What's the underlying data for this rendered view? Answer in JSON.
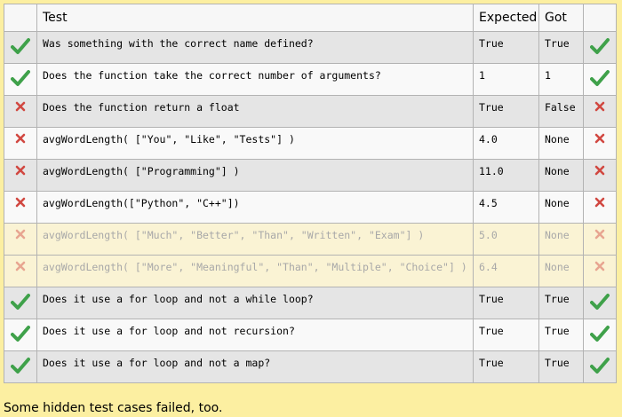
{
  "headers": {
    "test": "Test",
    "expected": "Expected",
    "got": "Got"
  },
  "rows": [
    {
      "test": "Was something with the correct name defined?",
      "expected": "True",
      "got": "True",
      "pass": true,
      "hidden": false
    },
    {
      "test": "Does the function take the correct number of arguments?",
      "expected": "1",
      "got": "1",
      "pass": true,
      "hidden": false
    },
    {
      "test": "Does the function return a float",
      "expected": "True",
      "got": "False",
      "pass": false,
      "hidden": false
    },
    {
      "test": "avgWordLength( [\"You\", \"Like\", \"Tests\"] )",
      "expected": "4.0",
      "got": "None",
      "pass": false,
      "hidden": false
    },
    {
      "test": "avgWordLength( [\"Programming\"] )",
      "expected": "11.0",
      "got": "None",
      "pass": false,
      "hidden": false
    },
    {
      "test": "avgWordLength([\"Python\", \"C++\"])",
      "expected": "4.5",
      "got": "None",
      "pass": false,
      "hidden": false
    },
    {
      "test": "avgWordLength( [\"Much\", \"Better\", \"Than\", \"Written\", \"Exam\"] )",
      "expected": "5.0",
      "got": "None",
      "pass": false,
      "hidden": true
    },
    {
      "test": "avgWordLength( [\"More\", \"Meaningful\", \"Than\", \"Multiple\", \"Choice\"] )",
      "expected": "6.4",
      "got": "None",
      "pass": false,
      "hidden": true
    },
    {
      "test": "Does it use a for loop and not a while loop?",
      "expected": "True",
      "got": "True",
      "pass": true,
      "hidden": false
    },
    {
      "test": "Does it use a for loop and not recursion?",
      "expected": "True",
      "got": "True",
      "pass": true,
      "hidden": false
    },
    {
      "test": "Does it use a for loop and not a map?",
      "expected": "True",
      "got": "True",
      "pass": true,
      "hidden": false
    }
  ],
  "footer": "Some hidden test cases failed, too.",
  "colors": {
    "pass": "#3fa14a",
    "fail": "#d14841"
  },
  "icons": {
    "pass": "check-icon",
    "fail": "cross-icon"
  }
}
